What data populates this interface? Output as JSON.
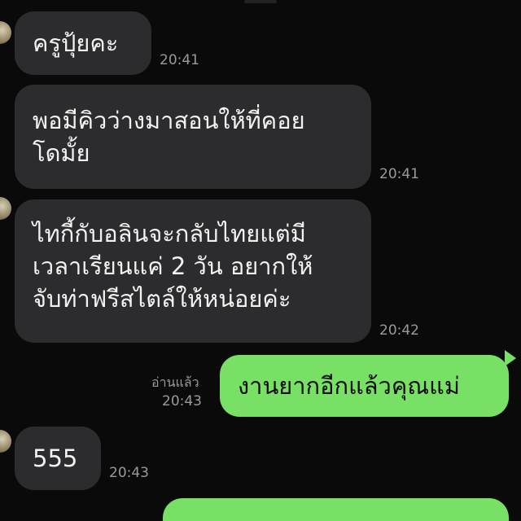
{
  "messages": [
    {
      "text": "ครูปุ้ยคะ",
      "time": "20:41"
    },
    {
      "text": "พอมีคิวว่างมาสอนให้ที่คอย\nโดมั้ย",
      "time": "20:41"
    },
    {
      "text": "ไทกี้กับอลินจะกลับไทยแต่มี\nเวลาเรียนแค่ 2 วัน อยากให้\nจับท่าฟรีสไตล์ให้หน่อยค่ะ",
      "time": "20:42"
    },
    {
      "text": "งานยากอีกแล้วคุณแม่",
      "time": "20:43",
      "read": "อ่านแล้ว"
    },
    {
      "text": "555",
      "time": "20:43"
    }
  ],
  "colors": {
    "incoming_bubble": "#2c2c2e",
    "outgoing_bubble": "#78e065",
    "background": "#0a0a0a"
  }
}
